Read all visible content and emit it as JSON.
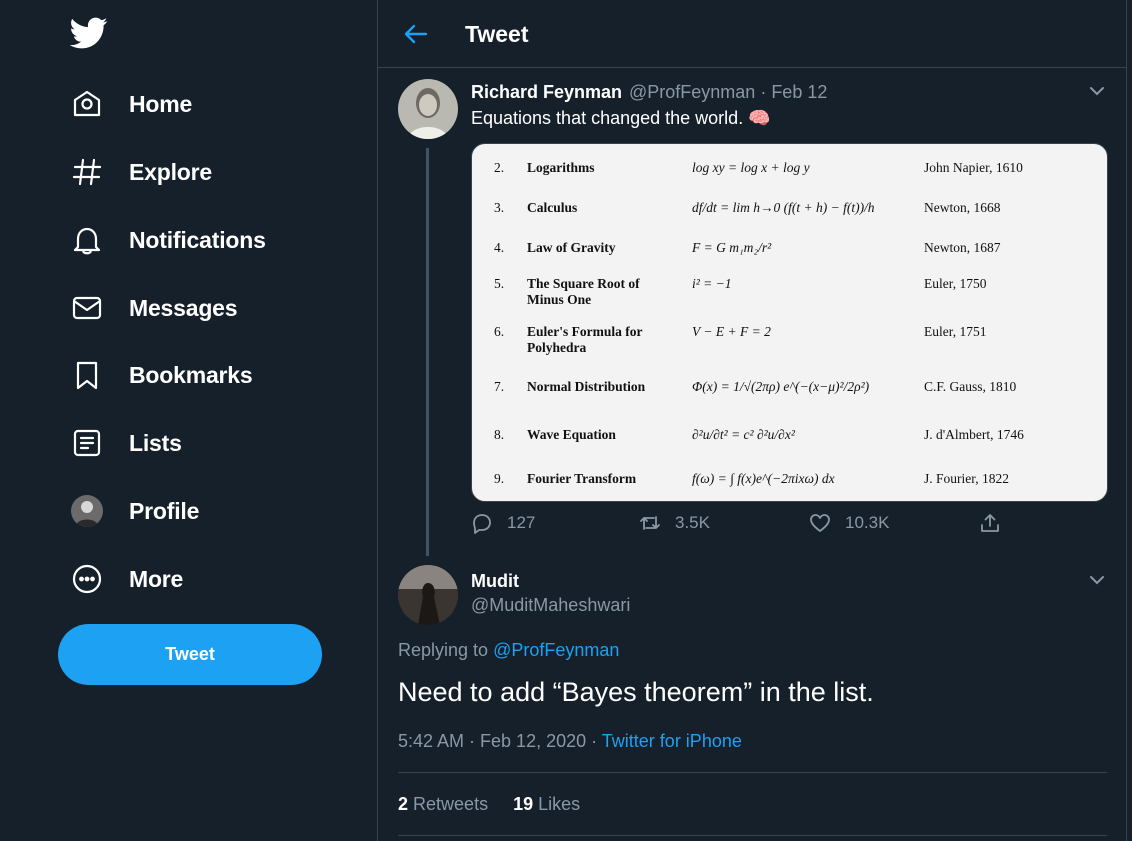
{
  "colors": {
    "background": "#15202b",
    "accent": "#1da1f2",
    "muted": "#8899a6",
    "border": "#38444d"
  },
  "sidebar": {
    "items": [
      {
        "label": "Home",
        "icon": "home-icon"
      },
      {
        "label": "Explore",
        "icon": "hashtag-icon"
      },
      {
        "label": "Notifications",
        "icon": "bell-icon"
      },
      {
        "label": "Messages",
        "icon": "envelope-icon"
      },
      {
        "label": "Bookmarks",
        "icon": "bookmark-icon"
      },
      {
        "label": "Lists",
        "icon": "list-icon"
      },
      {
        "label": "Profile",
        "icon": "avatar"
      },
      {
        "label": "More",
        "icon": "more-icon"
      }
    ],
    "tweet_button": "Tweet"
  },
  "header": {
    "title": "Tweet"
  },
  "tweet": {
    "author_name": "Richard Feynman",
    "meta": "@ProfFeynman · Feb 12",
    "text": "Equations that changed the world. 🧠",
    "equations": [
      {
        "num": "2.",
        "name": "Logarithms",
        "formula": "log xy = log x + log y",
        "author": "John Napier, 1610"
      },
      {
        "num": "3.",
        "name": "Calculus",
        "formula": "df/dt = lim h→0 (f(t + h) − f(t))/h",
        "author": "Newton, 1668"
      },
      {
        "num": "4.",
        "name": "Law of Gravity",
        "formula": "F = G m₁m₂/r²",
        "author": "Newton, 1687"
      },
      {
        "num": "5.",
        "name": "The Square Root of Minus One",
        "formula": "i² = −1",
        "author": "Euler, 1750"
      },
      {
        "num": "6.",
        "name": "Euler's Formula for Polyhedra",
        "formula": "V − E + F = 2",
        "author": "Euler, 1751"
      },
      {
        "num": "7.",
        "name": "Normal Distribution",
        "formula": "Φ(x) = 1/√(2πρ) e^(−(x−μ)²/2ρ²)",
        "author": "C.F. Gauss, 1810"
      },
      {
        "num": "8.",
        "name": "Wave Equation",
        "formula": "∂²u/∂t² = c² ∂²u/∂x²",
        "author": "J. d'Almbert, 1746"
      },
      {
        "num": "9.",
        "name": "Fourier Transform",
        "formula": "f(ω) = ∫ f(x)e^(−2πixω) dx",
        "author": "J. Fourier, 1822"
      }
    ],
    "replies": "127",
    "retweets": "3.5K",
    "likes": "10.3K"
  },
  "reply": {
    "author_name": "Mudit",
    "handle": "@MuditMaheshwari",
    "replying_prefix": "Replying to",
    "replying_to": "@ProfFeynman",
    "text": "Need to add “Bayes theorem” in the list.",
    "timestamp": "5:42 AM · Feb 12, 2020 · ",
    "source": "Twitter for iPhone",
    "retweets_count": "2",
    "retweets_label": "Retweets",
    "likes_count": "19",
    "likes_label": "Likes"
  }
}
